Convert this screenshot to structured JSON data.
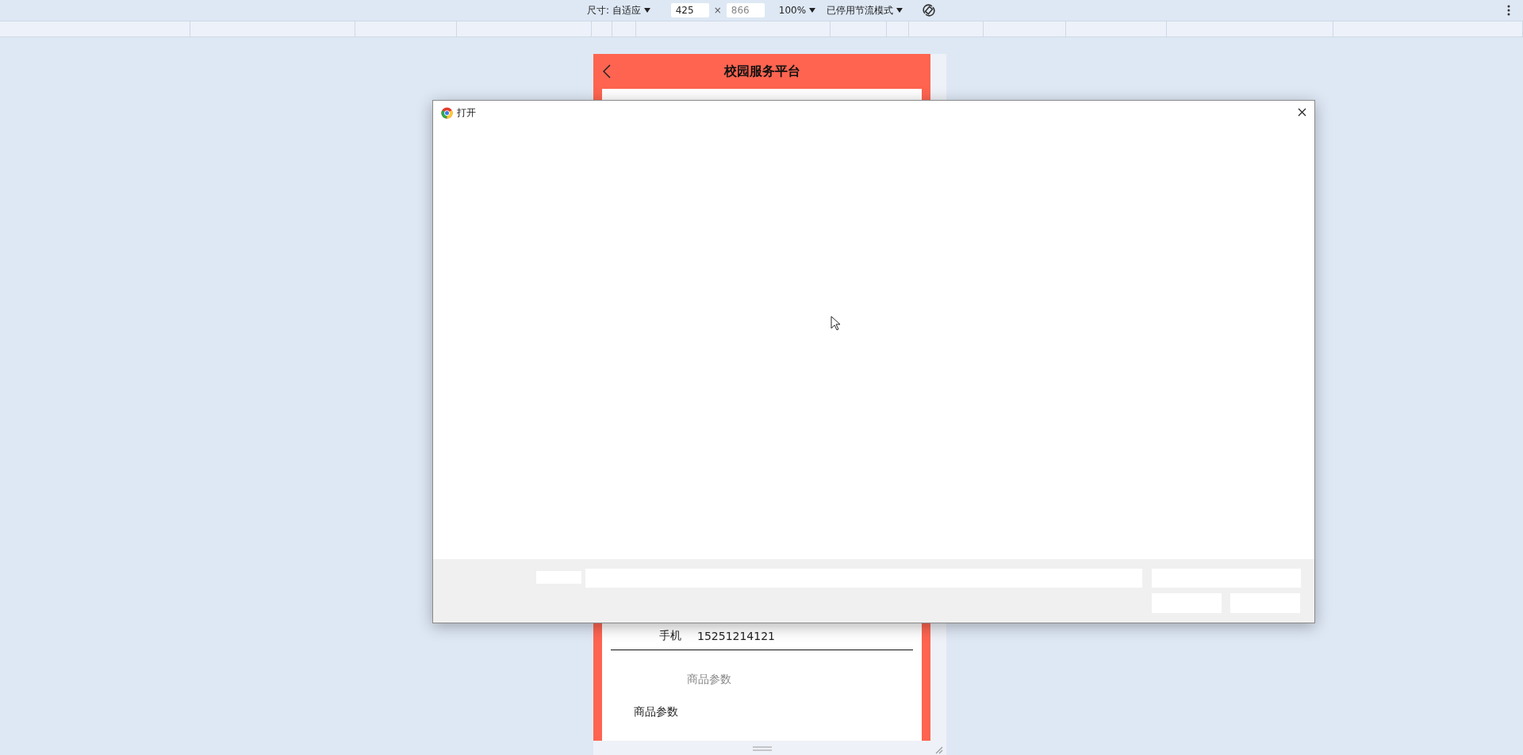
{
  "devtools_toolbar": {
    "dimensions_label": "尺寸: 自适应",
    "width_value": "425",
    "times_sign": "×",
    "height_value": "866",
    "zoom": "100%",
    "throttling": "已停用节流模式"
  },
  "phone": {
    "title": "校园服务平台",
    "phone_row": {
      "label": "手机",
      "value": "15251214121"
    },
    "section_field": {
      "placeholder": "商品参数"
    },
    "section_title": "商品参数"
  },
  "dialog": {
    "title": "打开"
  }
}
